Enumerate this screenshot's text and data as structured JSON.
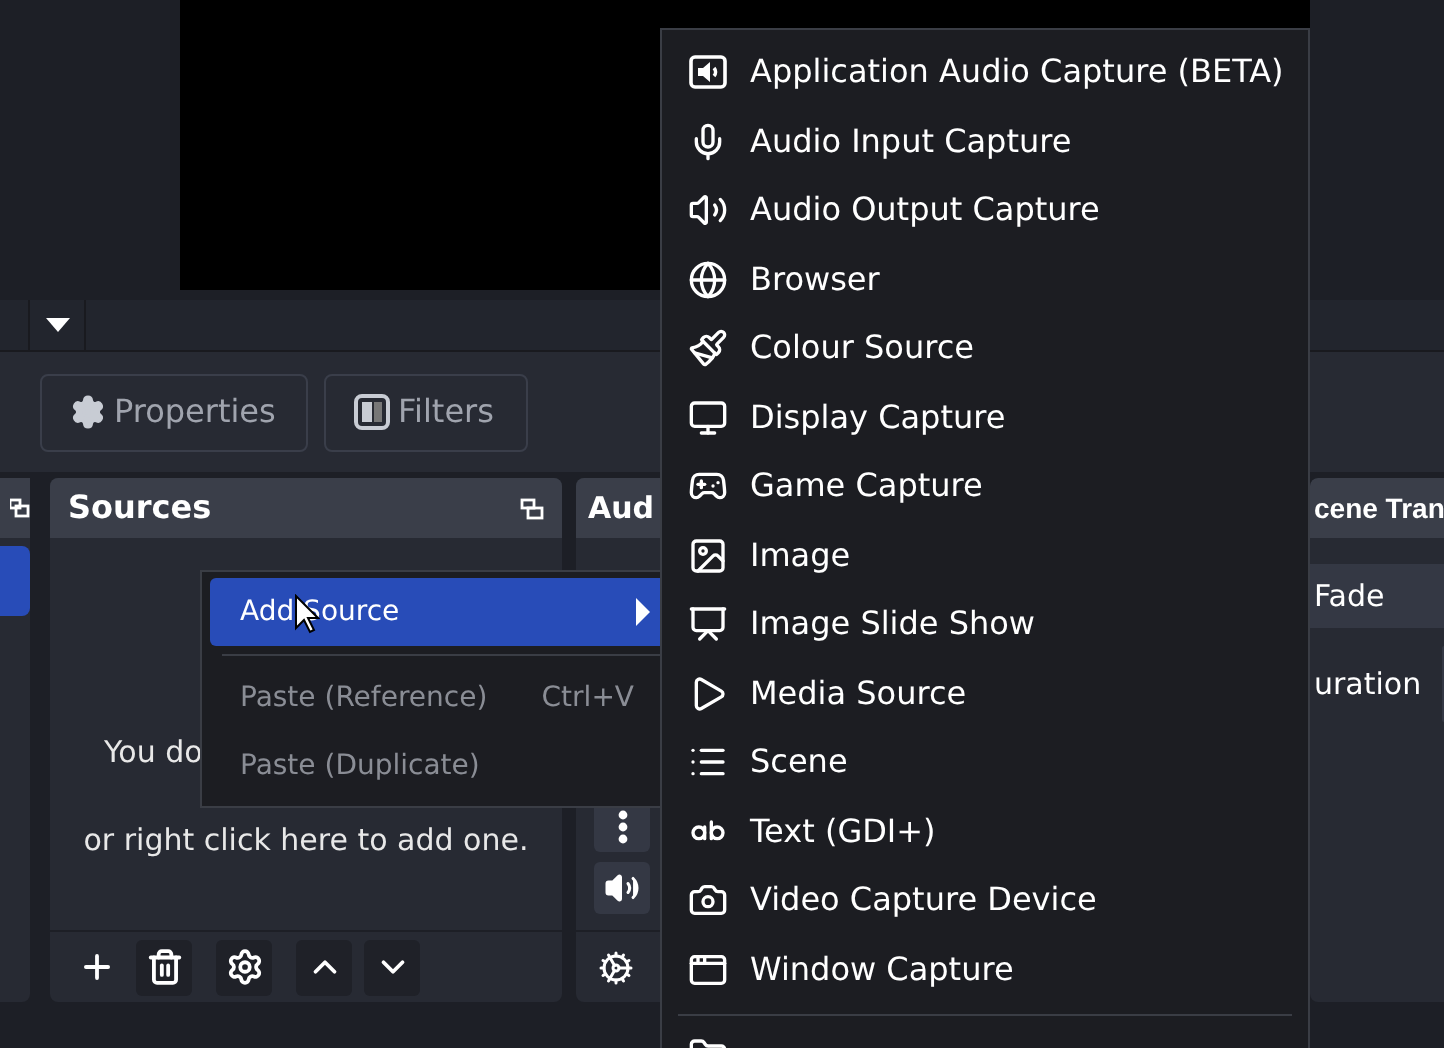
{
  "source_toolbar": {
    "buttons": [
      {
        "kind": "properties",
        "label": "Properties"
      },
      {
        "kind": "filters",
        "label": "Filters"
      }
    ]
  },
  "scenes_dock": {
    "items": [
      {
        "selected": true
      }
    ]
  },
  "sources_dock": {
    "title": "Sources",
    "empty_lines": [
      "You do",
      "or right click here to add one."
    ],
    "tools": [
      {
        "kind": "add"
      },
      {
        "kind": "remove"
      },
      {
        "kind": "settings"
      },
      {
        "kind": "up"
      },
      {
        "kind": "down"
      }
    ]
  },
  "audio_dock": {
    "title": "Aud"
  },
  "transitions_dock": {
    "title": "cene Tran",
    "transition": "Fade",
    "duration_label": "uration"
  },
  "context_menu": {
    "items": [
      {
        "kind": "submenu",
        "label": "Add Source",
        "selected": true,
        "disabled": false
      },
      {
        "kind": "separator"
      },
      {
        "kind": "item",
        "label": "Paste (Reference)",
        "shortcut": "Ctrl+V",
        "selected": false,
        "disabled": true
      },
      {
        "kind": "item",
        "label": "Paste (Duplicate)",
        "selected": false,
        "disabled": true
      }
    ]
  },
  "add_source_menu": {
    "items": [
      {
        "kind": "app-audio",
        "label": "Application Audio Capture (BETA)"
      },
      {
        "kind": "mic",
        "label": "Audio Input Capture"
      },
      {
        "kind": "speaker",
        "label": "Audio Output Capture"
      },
      {
        "kind": "globe",
        "label": "Browser"
      },
      {
        "kind": "brush",
        "label": "Colour Source"
      },
      {
        "kind": "monitor",
        "label": "Display Capture"
      },
      {
        "kind": "gamepad",
        "label": "Game Capture"
      },
      {
        "kind": "image",
        "label": "Image"
      },
      {
        "kind": "slides",
        "label": "Image Slide Show"
      },
      {
        "kind": "play",
        "label": "Media Source"
      },
      {
        "kind": "list",
        "label": "Scene"
      },
      {
        "kind": "text",
        "label": "Text (GDI+)"
      },
      {
        "kind": "camera",
        "label": "Video Capture Device"
      },
      {
        "kind": "window",
        "label": "Window Capture"
      }
    ]
  }
}
